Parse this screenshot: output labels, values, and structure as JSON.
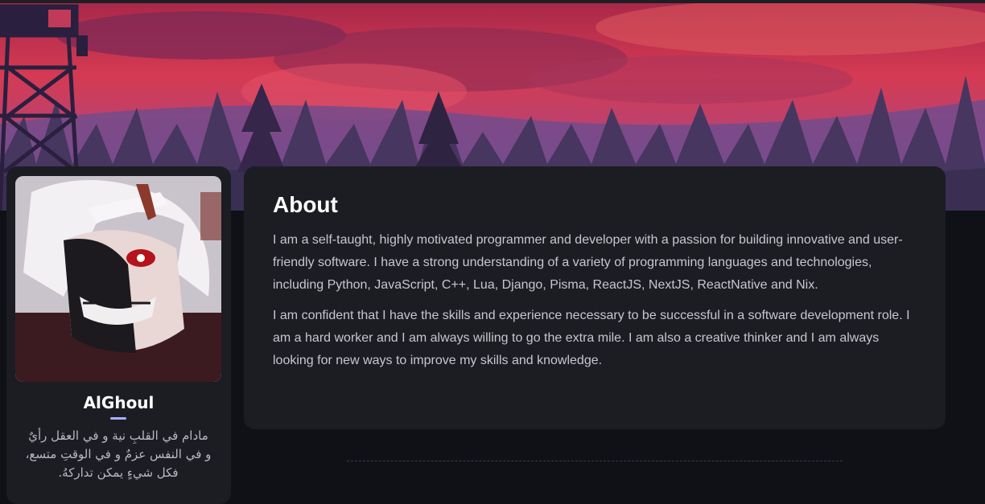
{
  "profile": {
    "avatar_alt": "anime character avatar",
    "username": "AlGhoul",
    "bio_lines": [
      "مادام في القلبِ نية و في العقل رأيٌ",
      "و في النفس عزمٌ و في الوقتِ متسع،",
      "فكل شيءٍ يمكن تداركهُ."
    ]
  },
  "about": {
    "title": "About",
    "paragraphs": [
      "I am a self-taught, highly motivated programmer and developer with a passion for building innovative and user-friendly software. I have a strong understanding of a variety of programming languages and technologies, including Python, JavaScript, C++, Lua, Django, Pisma, ReactJS, NextJS, ReactNative and Nix.",
      "I am confident that I have the skills and experience necessary to be successful in a software development role. I am a hard worker and I am always willing to go the extra mile. I am also a creative thinker and I am always looking for new ways to improve my skills and knowledge."
    ]
  },
  "colors": {
    "page_bg": "#0f1116",
    "card_bg": "#1b1d23",
    "accent": "#a8b1ff",
    "banner_sky": "#d83a4e"
  }
}
